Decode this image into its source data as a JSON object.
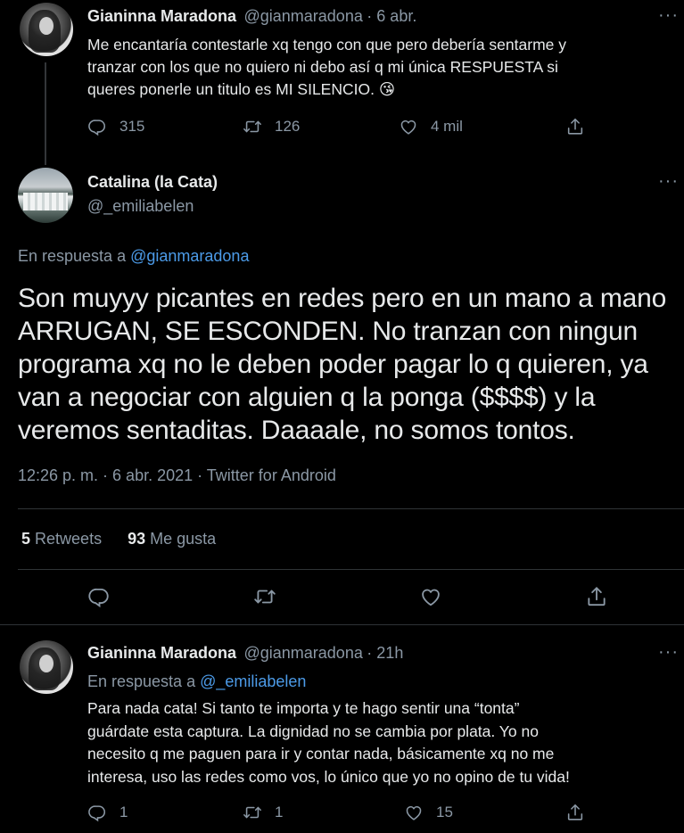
{
  "tweet1": {
    "author_name": "Gianinna Maradona",
    "author_handle": "@gianmaradona",
    "time": "· 6 abr.",
    "text_lines": [
      "Me encantaría contestarle xq tengo con que pero debería sentarme y",
      "tranzar con los que no quiero ni debo así q mi única RESPUESTA si",
      "queres ponerle un titulo es MI SILENCIO."
    ],
    "emoji": "😘",
    "replies": "315",
    "retweets": "126",
    "likes": "4 mil"
  },
  "tweet2": {
    "author_name": "Catalina (la Cata)",
    "author_handle": "@_emiliabelen",
    "reply_prefix": "En respuesta a",
    "reply_to": "@gianmaradona",
    "text_lines": [
      "Son muyyy picantes en redes pero en un mano a mano",
      "ARRUGAN, SE ESCONDEN. No tranzan con ningun",
      "programa xq no le deben poder pagar lo q quieren, ya",
      "van a negociar con alguien q la ponga ($$$$) y la",
      "veremos sentaditas. Daaaale, no somos tontos."
    ],
    "timestamp": "12:26 p. m. · 6 abr. 2021 · Twitter for Android",
    "retweets_count": "5",
    "retweets_label": "Retweets",
    "likes_count": "93",
    "likes_label": "Me gusta"
  },
  "tweet3": {
    "author_name": "Gianinna Maradona",
    "author_handle": "@gianmaradona",
    "time": "· 21h",
    "reply_prefix": "En respuesta a",
    "reply_to": "@_emiliabelen",
    "text_lines": [
      "Para nada cata! Si tanto te importa y te hago sentir una “tonta”",
      "guárdate esta captura. La dignidad no se cambia por plata. Yo no",
      "necesito q me paguen para ir y contar nada, básicamente xq no me",
      "interesa, uso las redes como vos, lo único que yo no opino de tu vida!"
    ],
    "replies": "1",
    "retweets": "1",
    "likes": "15"
  },
  "icons": [
    "more-icon",
    "reply-icon",
    "retweet-icon",
    "like-icon",
    "share-icon"
  ],
  "colors": {
    "background": "#000000",
    "text": "#e7e9ea",
    "muted": "#8b98a5",
    "link": "#4c9be8",
    "divider": "#2f3336"
  }
}
